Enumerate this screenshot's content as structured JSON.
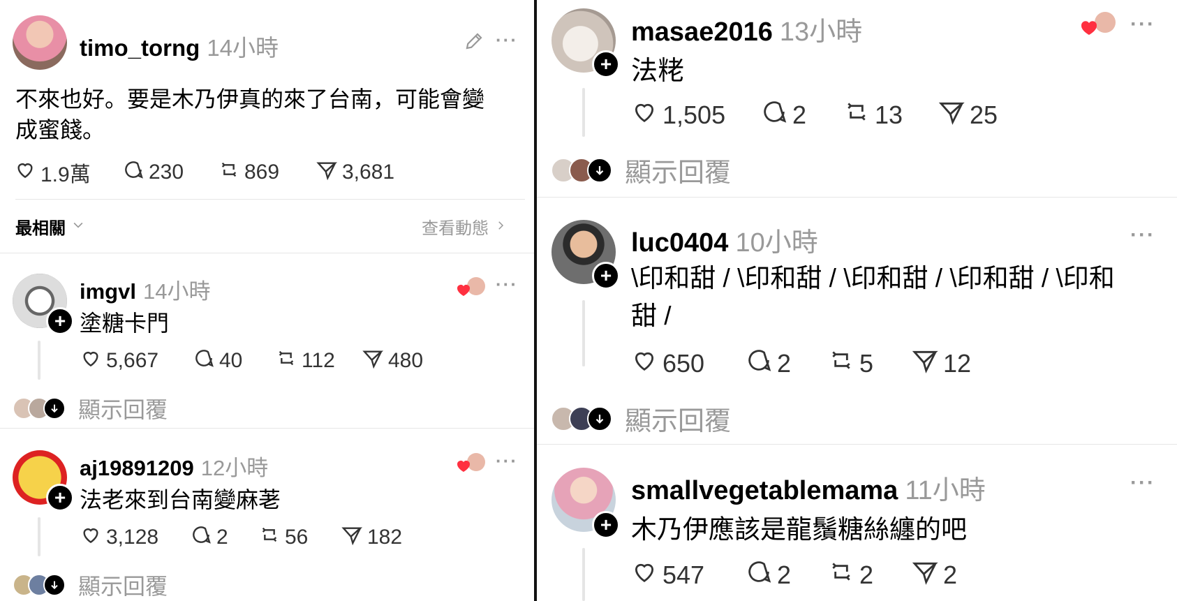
{
  "post": {
    "username": "timo_torng",
    "time": "14小時",
    "text": "不來也好。要是木乃伊真的來了台南，可能會變\n成蜜餞。",
    "likes": "1.9萬",
    "comments": "230",
    "reposts": "869",
    "shares": "3,681"
  },
  "sort": {
    "label": "最相關",
    "view_activity": "查看動態"
  },
  "show_replies_label": "顯示回覆",
  "left_replies": [
    {
      "username": "imgvl",
      "time": "14小時",
      "text": "塗糖卡門",
      "likes": "5,667",
      "comments": "40",
      "reposts": "112",
      "shares": "480"
    },
    {
      "username": "aj19891209",
      "time": "12小時",
      "text": "法老來到台南變麻荖",
      "likes": "3,128",
      "comments": "2",
      "reposts": "56",
      "shares": "182"
    }
  ],
  "right_replies": [
    {
      "username": "masae2016",
      "time": "13小時",
      "text": "法粩",
      "likes": "1,505",
      "comments": "2",
      "reposts": "13",
      "shares": "25"
    },
    {
      "username": "luc0404",
      "time": "10小時",
      "text": "\\印和甜 / \\印和甜 / \\印和甜 / \\印和甜 / \\印和\n甜 /",
      "likes": "650",
      "comments": "2",
      "reposts": "5",
      "shares": "12"
    },
    {
      "username": "smallvegetablemama",
      "time": "11小時",
      "text": "木乃伊應該是龍鬚糖絲纏的吧",
      "likes": "547",
      "comments": "2",
      "reposts": "2",
      "shares": "2"
    }
  ],
  "more_label": "···",
  "follow_symbol": "+",
  "icons": {
    "like": "heart-icon",
    "comment": "comment-bubble-icon",
    "repost": "repost-icon",
    "share": "send-icon",
    "edit": "pencil-icon",
    "chevron_down": "chevron-down-icon",
    "chevron_right": "chevron-right-icon",
    "creator_liked": "creator-liked-heart-icon"
  },
  "colors": {
    "secondary_text": "#999999",
    "like_red": "#ff3040",
    "follow_badge": "#000000"
  }
}
